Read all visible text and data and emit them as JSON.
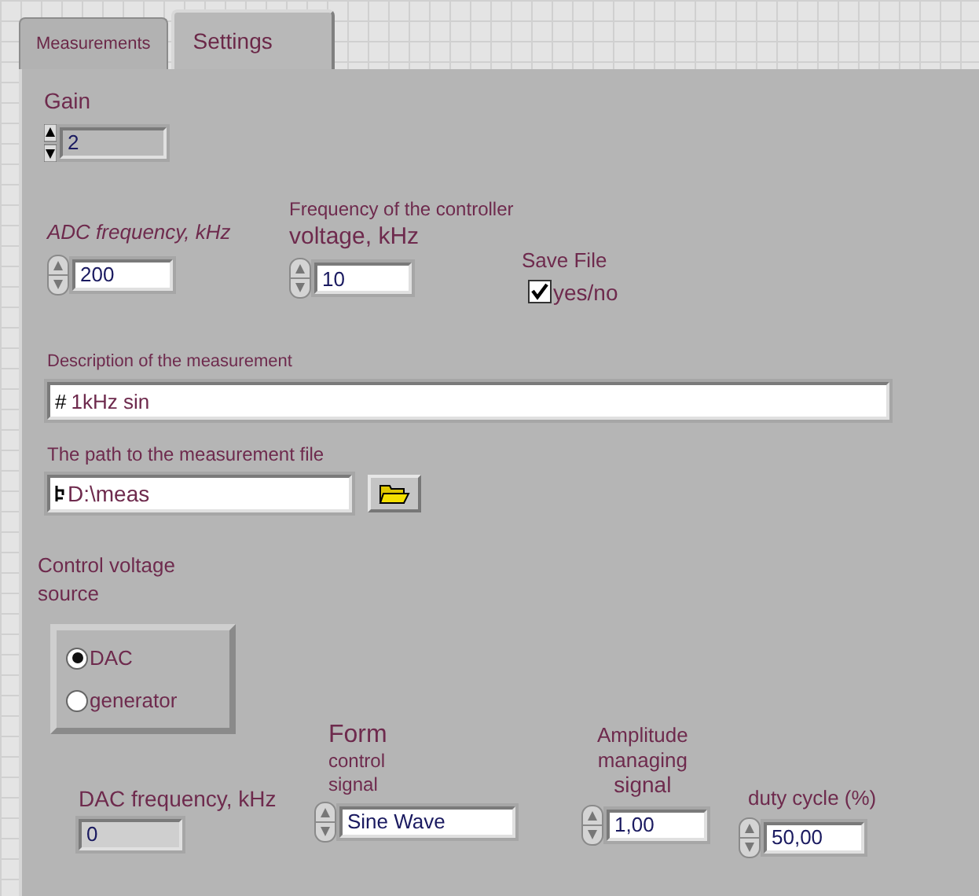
{
  "tabs": [
    {
      "label": "Measurements",
      "selected": false
    },
    {
      "label": "Settings",
      "selected": true
    }
  ],
  "gain": {
    "label": "Gain",
    "value": "2"
  },
  "adc_frequency": {
    "label": "ADC frequency, kHz",
    "value": "200"
  },
  "controller_frequency": {
    "label_lines": [
      "Frequency of the controller",
      "voltage, kHz"
    ],
    "value": "10"
  },
  "save_file": {
    "label": "Save File",
    "option": "yes/no",
    "checked": true
  },
  "description": {
    "label": "Description of the measurement",
    "prefix": "#",
    "value": "1kHz sin"
  },
  "path": {
    "label": "The path to the measurement file",
    "value": "D:\\meas"
  },
  "control_voltage_source": {
    "label_lines": [
      "Control voltage",
      "source"
    ],
    "options": [
      {
        "label": "DAC",
        "selected": true
      },
      {
        "label": "generator",
        "selected": false
      }
    ]
  },
  "dac_frequency": {
    "label": "DAC frequency, kHz",
    "value": "0"
  },
  "form": {
    "label_lines": [
      "Form",
      "control",
      "signal"
    ],
    "value": "Sine Wave"
  },
  "amplitude": {
    "label_lines": [
      "Amplitude",
      "managing",
      "signal"
    ],
    "value": "1,00"
  },
  "duty_cycle": {
    "label": "duty cycle (%)",
    "value": "50,00"
  }
}
